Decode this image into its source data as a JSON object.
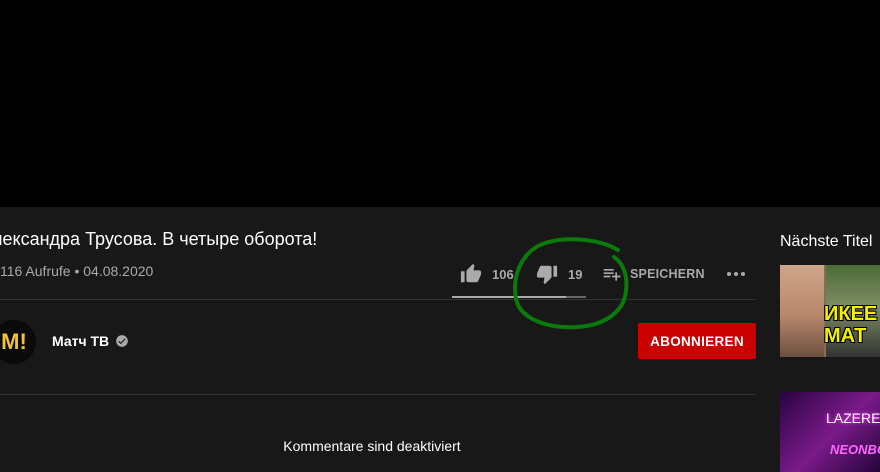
{
  "video": {
    "title": "лександра Трусова. В четыре оборота!",
    "meta": "116 Aufrufe • 04.08.2020"
  },
  "actions": {
    "likes": "106",
    "dislikes": "19",
    "save_label": "SPEICHERN",
    "like_ratio": 0.848
  },
  "channel": {
    "name": "Матч ТВ",
    "avatar_text": "M!",
    "subscribe_label": "ABONNIEREN"
  },
  "comments": {
    "status": "Kommentare sind deaktiviert"
  },
  "sidebar": {
    "heading": "Nächste Titel",
    "thumb1_text": "ИКЕЕ МАТ",
    "thumb2_text1": "LAZERE",
    "thumb2_text2": "NEONBOMB"
  },
  "colors": {
    "accent_red": "#cc0000",
    "annotation_green": "#0a7a0a",
    "background": "#181818"
  }
}
